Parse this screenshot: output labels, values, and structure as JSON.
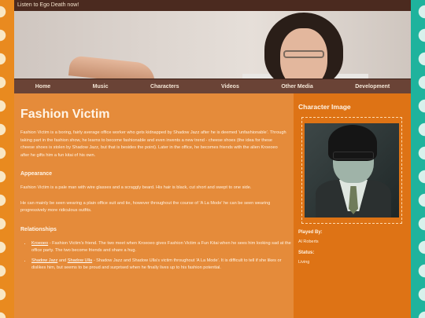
{
  "topbar": {
    "link_text": "Listen to Ego Death now!"
  },
  "nav": {
    "items": [
      "Home",
      "Music",
      "Characters",
      "Videos",
      "Other Media",
      "Development"
    ]
  },
  "main": {
    "title": "Fashion Victim",
    "intro": "Fashion Victim is a boring, fairly average office worker who gets kidnapped by Shadow Jazz after he is deemed 'unfashionable'. Through taking part in the fashion show, he learns to become fashionable and even invents a new trend - cheese shoes (the idea for these cheese shoes is stolen by Shadow Jazz, but that is besides the point). Later in the office, he becomes friends with the alien Kroeoeo after he gifts him a fun kitai of his own.",
    "appearance_heading": "Appearance",
    "appearance_p1": "Fashion Victim is a pale man with wire glasses and a scraggly beard. His hair is black, cut short and swept to one side.",
    "appearance_p2": "He can mainly be seen wearing a plain office suit and tie, however throughout the course of 'A La Mode' he can be seen wearing progressively more ridiculous outfits.",
    "relationships_heading": "Relationships",
    "relationships": [
      {
        "link": "Kroeoeo",
        "text": " - Fashion Victim's friend. The two meet when Kroeoeo gives Fashion Victim a Fun Kitai when he sees him looking sad at the office party. The two become friends and share a hug."
      },
      {
        "link": "Shadow Jazz",
        "and": " and ",
        "link2": "Shadow Ulla",
        "text": " - Shadow Jazz and Shadow Ulla's victim throughout 'A La Mode'. It is difficult to tell if she likes or dislikes him, but seems to be proud and surprised when he finally lives up to his fashion potential."
      }
    ]
  },
  "aside": {
    "heading": "Character Image",
    "played_by_label": "Played By:",
    "played_by_value": "Al Roberts",
    "status_label": "Status:",
    "status_value": "Living"
  }
}
